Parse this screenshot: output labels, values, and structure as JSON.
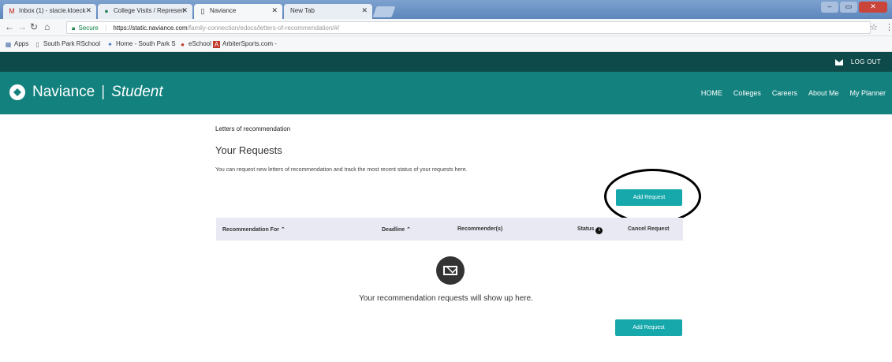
{
  "browser": {
    "tabs": [
      {
        "title": "Inbox (1) - stacie.kloeck",
        "icon": "gmail-icon",
        "color": "#c5221f"
      },
      {
        "title": "College Visits / Represen",
        "icon": "college-icon",
        "color": "#2e8b57"
      },
      {
        "title": "Naviance",
        "icon": "page-icon",
        "color": "#555555"
      },
      {
        "title": "New Tab",
        "icon": "",
        "color": "#555555"
      }
    ],
    "secure_label": "Secure",
    "url_host": "https://static.naviance.com",
    "url_path": "/family-connection/edocs/letters-of-recommendation/#/",
    "bookmarks": [
      {
        "label": "Apps",
        "icon": "apps-icon"
      },
      {
        "label": "South Park RSchool",
        "icon": "page-icon"
      },
      {
        "label": "Home - South Park S",
        "icon": "home-icon"
      },
      {
        "label": "eSchool",
        "icon": "eschool-icon"
      },
      {
        "label": "ArbiterSports.com -",
        "icon": "arbiter-icon"
      }
    ]
  },
  "header": {
    "logout_label": "LOG OUT",
    "brand_name": "Naviance",
    "brand_sub": "Student",
    "nav": [
      "HOME",
      "Colleges",
      "Careers",
      "About Me",
      "My Planner"
    ],
    "colors": {
      "dark": "#0e4a4a",
      "brand": "#13827f",
      "accent": "#16a8ab"
    }
  },
  "main": {
    "breadcrumb": "Letters of recommendation",
    "title": "Your Requests",
    "intro": "You can request new letters of recommendation and track the most recent status of your requests here.",
    "add_request_label": "Add Request",
    "table_headers": {
      "recommendation_for": "Recommendation For",
      "deadline": "Deadline",
      "recommenders": "Recommender(s)",
      "status": "Status",
      "cancel": "Cancel Request"
    },
    "empty_message": "Your recommendation requests will show up here."
  }
}
